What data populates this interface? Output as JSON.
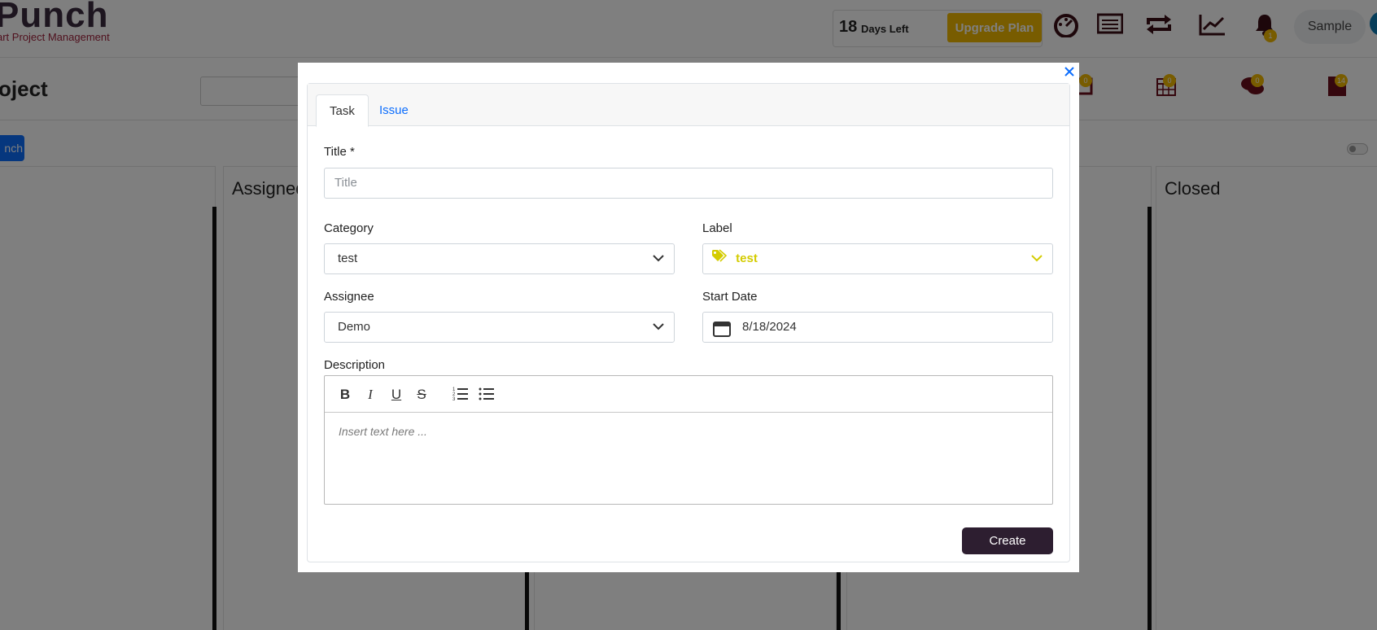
{
  "app": {
    "logo": "Punch",
    "logo_tagline": "art Project Management",
    "days_left_number": "18",
    "days_left_text": "Days Left",
    "upgrade_label": "Upgrade Plan",
    "notification_count": "1",
    "user_label": "Sample",
    "top_icons": [
      "dashboard-icon",
      "list-icon",
      "repeat-icon",
      "trend-chart-icon",
      "bell-icon"
    ]
  },
  "project": {
    "title": "oject",
    "launch_label": "nch",
    "icon_badges": [
      "0",
      "0",
      "0",
      "14"
    ],
    "columns": [
      "Assigned",
      "Closed"
    ]
  },
  "modal": {
    "tabs": [
      {
        "label": "Task",
        "active": true
      },
      {
        "label": "Issue",
        "active": false
      }
    ],
    "title_label": "Title *",
    "title_placeholder": "Title",
    "category_label": "Category",
    "category_value": "test",
    "label_label": "Label",
    "label_value": "test",
    "label_color": "#d4cc00",
    "assignee_label": "Assignee",
    "assignee_value": "Demo",
    "start_date_label": "Start Date",
    "start_date_value": "8/18/2024",
    "description_label": "Description",
    "description_placeholder": "Insert text here ...",
    "toolbar": [
      "B",
      "I",
      "U",
      "S"
    ],
    "create_label": "Create"
  },
  "colors": {
    "primary": "#0d6efd",
    "brand_dark": "#2d1e30",
    "accent_yellow": "#f0b800"
  }
}
